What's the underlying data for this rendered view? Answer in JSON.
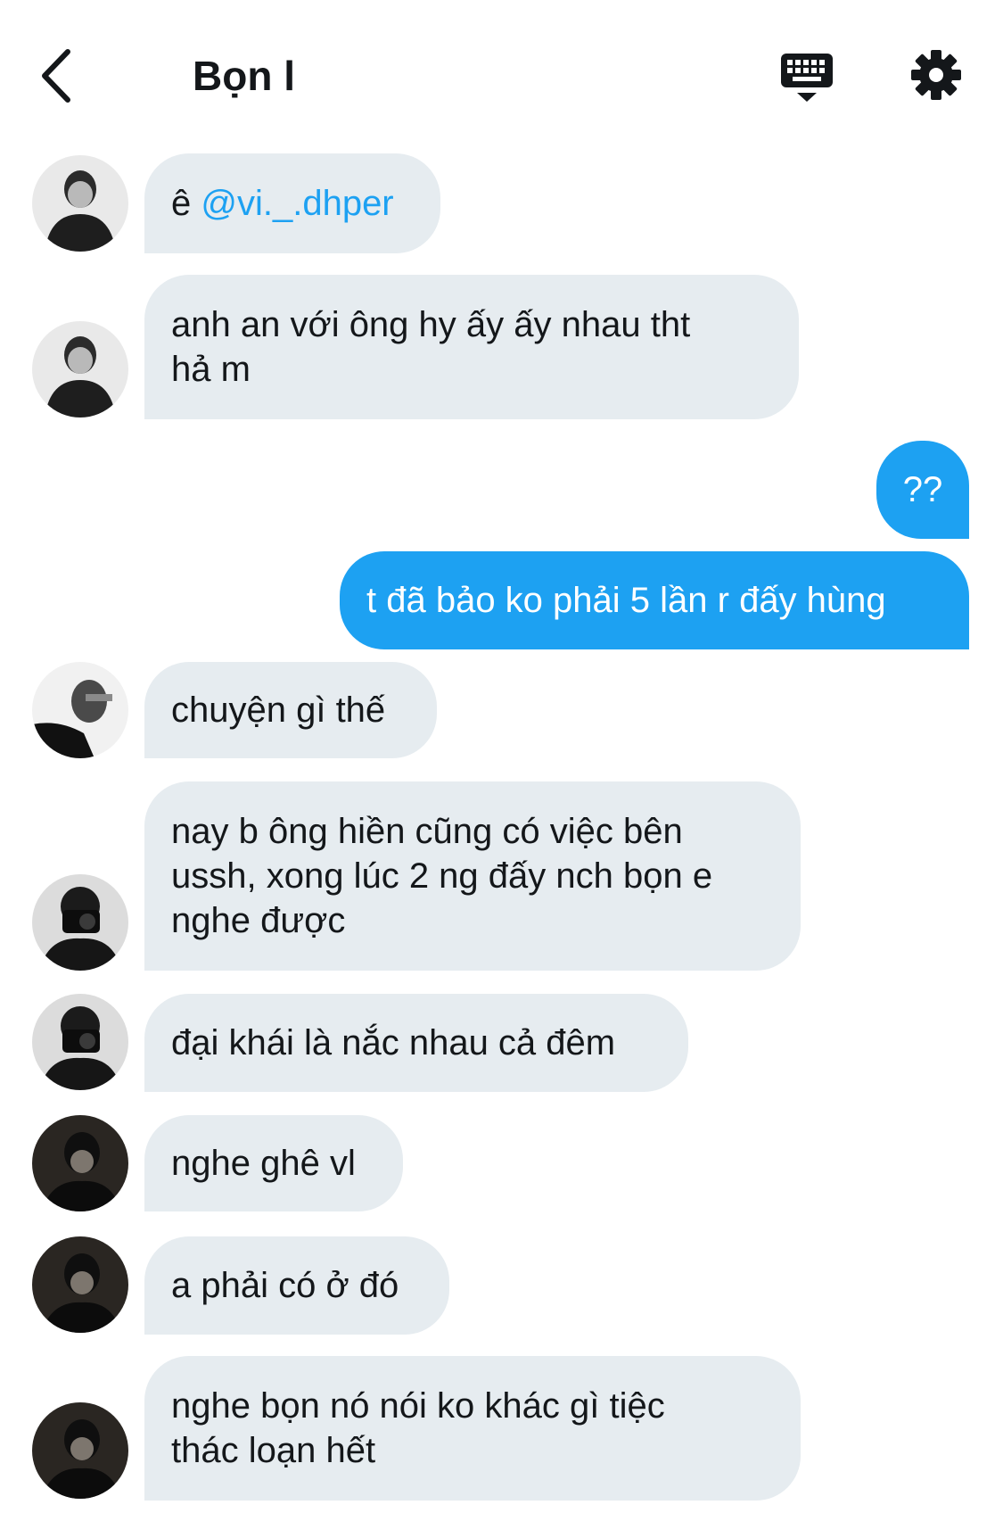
{
  "header": {
    "back_icon": "chevron-left-icon",
    "title": "Bọn l",
    "keyboard_icon": "keyboard-icon",
    "settings_icon": "gear-icon"
  },
  "colors": {
    "incoming_bubble": "#e6ecf0",
    "outgoing_bubble": "#1da1f2",
    "mention": "#1da1f2"
  },
  "messages": [
    {
      "direction": "in",
      "prefix": "ê ",
      "mention": "@vi._.dhper"
    },
    {
      "direction": "in",
      "lines": [
        "anh an với ông hy ấy ấy nhau tht",
        "hả m"
      ]
    },
    {
      "direction": "out",
      "lines": [
        "??"
      ]
    },
    {
      "direction": "out",
      "lines": [
        "t đã bảo ko phải 5 lần r đấy hùng"
      ]
    },
    {
      "direction": "in",
      "lines": [
        "chuyện gì thế"
      ]
    },
    {
      "direction": "in",
      "lines": [
        "nay b ông hiền cũng có việc bên",
        "ussh, xong lúc 2 ng đấy nch bọn e",
        "nghe được"
      ]
    },
    {
      "direction": "in",
      "lines": [
        "đại khái là nắc nhau cả đêm"
      ]
    },
    {
      "direction": "in",
      "lines": [
        "nghe ghê vl"
      ]
    },
    {
      "direction": "in",
      "lines": [
        "a phải có ở đó"
      ]
    },
    {
      "direction": "in",
      "lines": [
        "nghe bọn nó nói ko khác gì tiệc",
        "thác loạn hết"
      ]
    }
  ]
}
